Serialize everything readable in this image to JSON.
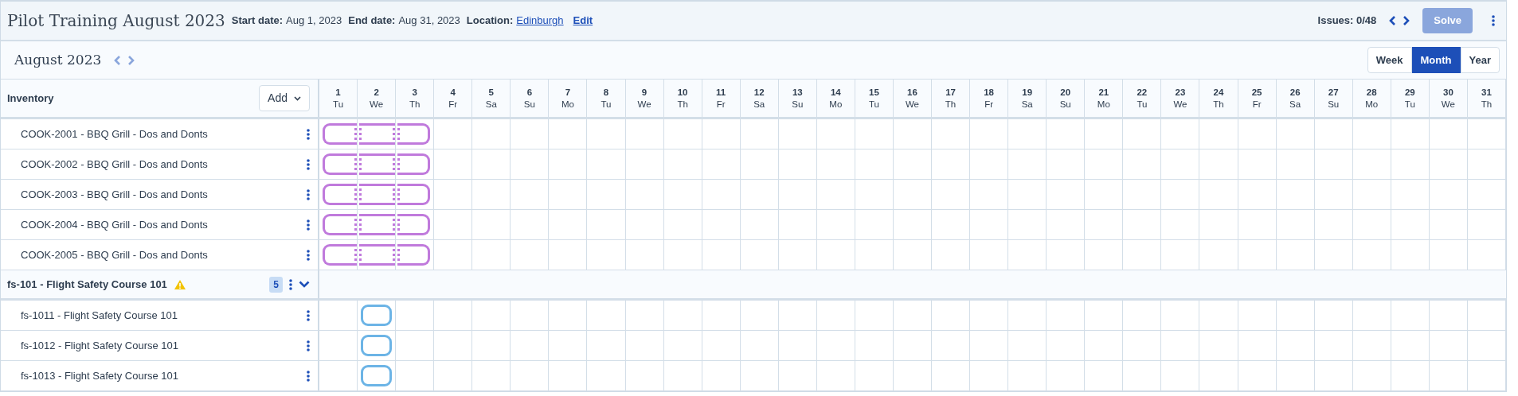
{
  "header": {
    "title": "Pilot Training August 2023",
    "fields": [
      {
        "label": "Start date:",
        "value": "Aug 1, 2023",
        "kind": "text"
      },
      {
        "label": "End date:",
        "value": "Aug 31, 2023",
        "kind": "text"
      },
      {
        "label": "Location:",
        "value": "Edinburgh",
        "kind": "link"
      }
    ],
    "edit": "Edit",
    "issues": "Issues: 0/48",
    "solve": {
      "label": "Solve",
      "disabled": true
    }
  },
  "toolbar": {
    "period": "August 2023",
    "views": [
      {
        "label": "Week",
        "selected": false
      },
      {
        "label": "Month",
        "selected": true
      },
      {
        "label": "Year",
        "selected": false
      }
    ]
  },
  "inventory": {
    "title": "Inventory",
    "add": "Add"
  },
  "days": [
    {
      "num": "1",
      "wd": "Tu"
    },
    {
      "num": "2",
      "wd": "We"
    },
    {
      "num": "3",
      "wd": "Th"
    },
    {
      "num": "4",
      "wd": "Fr"
    },
    {
      "num": "5",
      "wd": "Sa"
    },
    {
      "num": "6",
      "wd": "Su"
    },
    {
      "num": "7",
      "wd": "Mo"
    },
    {
      "num": "8",
      "wd": "Tu"
    },
    {
      "num": "9",
      "wd": "We"
    },
    {
      "num": "10",
      "wd": "Th"
    },
    {
      "num": "11",
      "wd": "Fr"
    },
    {
      "num": "12",
      "wd": "Sa"
    },
    {
      "num": "13",
      "wd": "Su"
    },
    {
      "num": "14",
      "wd": "Mo"
    },
    {
      "num": "15",
      "wd": "Tu"
    },
    {
      "num": "16",
      "wd": "We"
    },
    {
      "num": "17",
      "wd": "Th"
    },
    {
      "num": "18",
      "wd": "Fr"
    },
    {
      "num": "19",
      "wd": "Sa"
    },
    {
      "num": "20",
      "wd": "Su"
    },
    {
      "num": "21",
      "wd": "Mo"
    },
    {
      "num": "22",
      "wd": "Tu"
    },
    {
      "num": "23",
      "wd": "We"
    },
    {
      "num": "24",
      "wd": "Th"
    },
    {
      "num": "25",
      "wd": "Fr"
    },
    {
      "num": "26",
      "wd": "Sa"
    },
    {
      "num": "27",
      "wd": "Su"
    },
    {
      "num": "28",
      "wd": "Mo"
    },
    {
      "num": "29",
      "wd": "Tu"
    },
    {
      "num": "30",
      "wd": "We"
    },
    {
      "num": "31",
      "wd": "Th"
    }
  ],
  "items": [
    {
      "kind": "item",
      "label": "COOK-2001 - BBQ Grill - Dos and Donts",
      "color": "#c07adc",
      "cells": [
        {
          "kind": "start"
        },
        {
          "kind": "middle"
        },
        {
          "kind": "end"
        }
      ]
    },
    {
      "kind": "item",
      "label": "COOK-2002 - BBQ Grill - Dos and Donts",
      "color": "#c07adc",
      "cells": [
        {
          "kind": "start"
        },
        {
          "kind": "middle"
        },
        {
          "kind": "end"
        }
      ]
    },
    {
      "kind": "item",
      "label": "COOK-2003 - BBQ Grill - Dos and Donts",
      "color": "#c07adc",
      "cells": [
        {
          "kind": "start"
        },
        {
          "kind": "middle"
        },
        {
          "kind": "end"
        }
      ]
    },
    {
      "kind": "item",
      "label": "COOK-2004 - BBQ Grill - Dos and Donts",
      "color": "#c07adc",
      "cells": [
        {
          "kind": "start"
        },
        {
          "kind": "middle"
        },
        {
          "kind": "end"
        }
      ]
    },
    {
      "kind": "item",
      "label": "COOK-2005 - BBQ Grill - Dos and Donts",
      "color": "#c07adc",
      "cells": [
        {
          "kind": "start"
        },
        {
          "kind": "middle"
        },
        {
          "kind": "end"
        }
      ]
    },
    {
      "kind": "group",
      "label": "fs-101 - Flight Safety Course 101",
      "warning": true,
      "count": "5",
      "expanded": true,
      "children": [
        {
          "kind": "item",
          "label": "fs-1011 - Flight Safety Course 101",
          "color": "#6cb4e6",
          "cells": [
            {
              "kind": "empty"
            },
            {
              "kind": "single"
            }
          ]
        },
        {
          "kind": "item",
          "label": "fs-1012 - Flight Safety Course 101",
          "color": "#6cb4e6",
          "cells": [
            {
              "kind": "empty"
            },
            {
              "kind": "single"
            }
          ]
        },
        {
          "kind": "item",
          "label": "fs-1013 - Flight Safety Course 101",
          "color": "#6cb4e6",
          "cells": [
            {
              "kind": "empty"
            },
            {
              "kind": "single"
            }
          ]
        }
      ]
    }
  ]
}
